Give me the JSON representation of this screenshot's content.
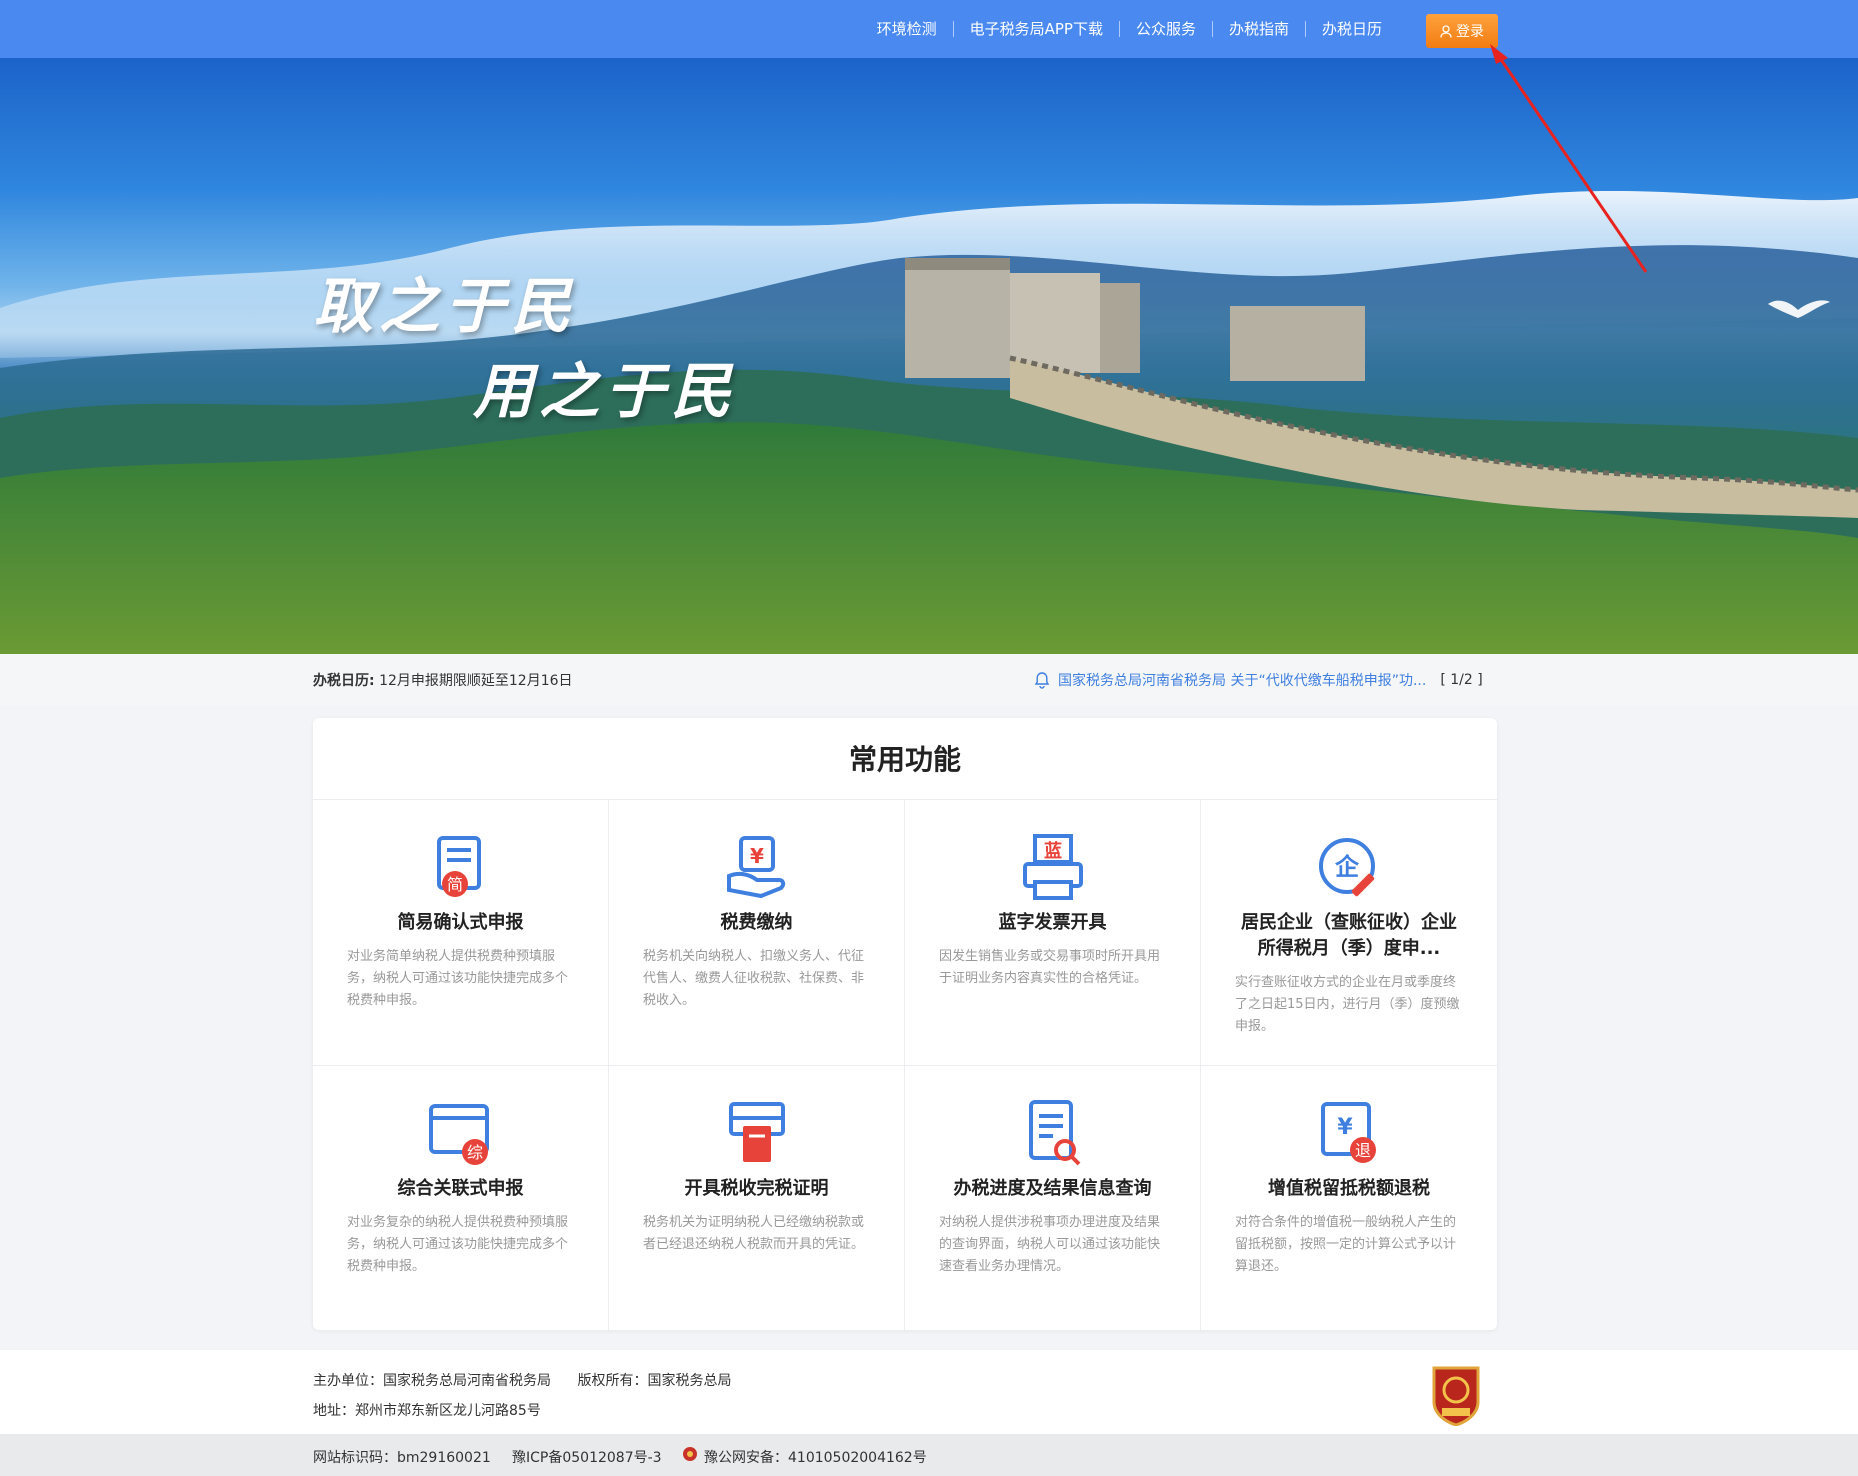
{
  "nav": {
    "items": [
      "环境检测",
      "电子税务局APP下载",
      "公众服务",
      "办税指南",
      "办税日历"
    ],
    "login_label": "登录"
  },
  "banner": {
    "slogan_line1": "取之于民",
    "slogan_line2": "用之于民"
  },
  "strip": {
    "calendar_label": "办税日历:",
    "calendar_text": "12月申报期限顺延至12月16日",
    "notice_text": "国家税务总局河南省税务局 关于“代收代缴车船税申报”功...",
    "notice_pager": "[ 1/2 ]"
  },
  "functions": {
    "title": "常用功能",
    "items": [
      {
        "name": "简易确认式申报",
        "desc": "对业务简单纳税人提供税费种预填服务，纳税人可通过该功能快捷完成多个税费种申报。",
        "icon": "simple-declare-icon",
        "badge": "简"
      },
      {
        "name": "税费缴纳",
        "desc": "税务机关向纳税人、扣缴义务人、代征代售人、缴费人征收税款、社保费、非税收入。",
        "icon": "tax-payment-icon",
        "badge": "¥"
      },
      {
        "name": "蓝字发票开具",
        "desc": "因发生销售业务或交易事项时所开具用于证明业务内容真实性的合格凭证。",
        "icon": "invoice-print-icon",
        "badge": "蓝"
      },
      {
        "name": "居民企业（查账征收）企业所得税月（季）度申...",
        "desc": "实行查账征收方式的企业在月或季度终了之日起15日内，进行月（季）度预缴申报。",
        "icon": "enterprise-tax-icon",
        "badge": "企"
      },
      {
        "name": "综合关联式申报",
        "desc": "对业务复杂的纳税人提供税费种预填服务，纳税人可通过该功能快捷完成多个税费种申报。",
        "icon": "combined-declare-icon",
        "badge": "综"
      },
      {
        "name": "开具税收完税证明",
        "desc": "税务机关为证明纳税人已经缴纳税款或者已经退还纳税人税款而开具的凭证。",
        "icon": "tax-certificate-icon",
        "badge": ""
      },
      {
        "name": "办税进度及结果信息查询",
        "desc": "对纳税人提供涉税事项办理进度及结果的查询界面，纳税人可以通过该功能快速查看业务办理情况。",
        "icon": "progress-query-icon",
        "badge": ""
      },
      {
        "name": "增值税留抵税额退税",
        "desc": "对符合条件的增值税一般纳税人产生的留抵税额，按照一定的计算公式予以计算退还。",
        "icon": "vat-refund-icon",
        "badge": "退"
      }
    ]
  },
  "footer": {
    "host": "主办单位：国家税务总局河南省税务局",
    "copyright": "版权所有：国家税务总局",
    "address": "地址：郑州市郑东新区龙儿河路85号",
    "site_code": "网站标识码：bm29160021",
    "icp": "豫ICP备05012087号-3",
    "police": "豫公网安备：41010502004162号"
  },
  "colors": {
    "nav_bg": "#4a89ef",
    "login_bg": "#f58a1f",
    "icon_blue": "#3f7fe0",
    "icon_red": "#e8433a",
    "notice_blue": "#3f7fe0"
  }
}
